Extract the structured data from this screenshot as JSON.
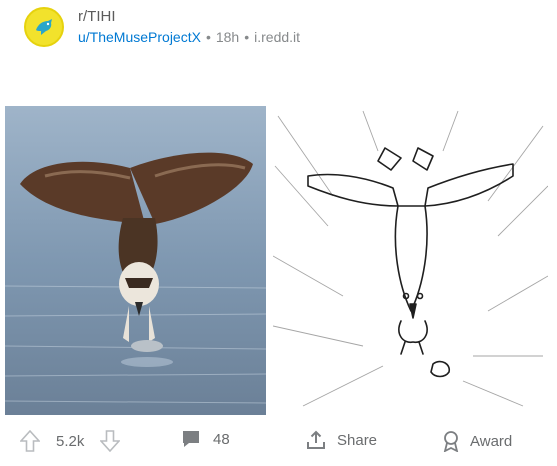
{
  "post": {
    "subreddit": "r/TIHI",
    "author": "u/TheMuseProjectX",
    "age": "18h",
    "domain": "i.redd.it",
    "separator": "•"
  },
  "actions": {
    "vote_count": "5.2k",
    "comment_count": "48",
    "share_label": "Share",
    "award_label": "Award"
  },
  "icons": {
    "avatar": "subreddit-avatar-icon",
    "upvote": "upvote-arrow-icon",
    "downvote": "downvote-arrow-icon",
    "comment": "comment-bubble-icon",
    "share": "share-icon",
    "award": "award-icon"
  },
  "colors": {
    "avatar_bg": "#f2e22c",
    "username": "#0079d3",
    "meta_text": "#878a8c",
    "action_text": "#6a6c6e"
  }
}
